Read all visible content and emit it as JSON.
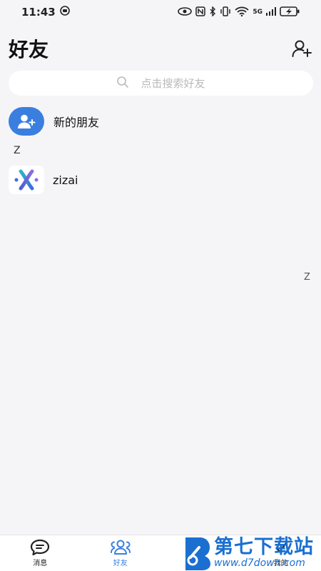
{
  "status_bar": {
    "time": "11:43",
    "network": "5G"
  },
  "header": {
    "title": "好友"
  },
  "search": {
    "placeholder": "点击搜索好友"
  },
  "new_friend": {
    "label": "新的朋友"
  },
  "contacts": {
    "section_letter": "Z",
    "items": [
      {
        "name": "zizai"
      }
    ]
  },
  "index_bar": {
    "letters": [
      "Z"
    ]
  },
  "tab_bar": {
    "tabs": [
      {
        "label": "消息",
        "icon": "message-icon"
      },
      {
        "label": "好友",
        "icon": "friends-icon",
        "active": true
      },
      {
        "label": "",
        "icon": "discover-icon"
      },
      {
        "label": "我的",
        "icon": "profile-icon"
      }
    ]
  },
  "watermark": {
    "text": "第七下载站",
    "url": "www.d7down.com"
  },
  "colors": {
    "accent": "#3a7fe0",
    "background": "#f5f5f7",
    "watermark": "#1a6fd1"
  }
}
